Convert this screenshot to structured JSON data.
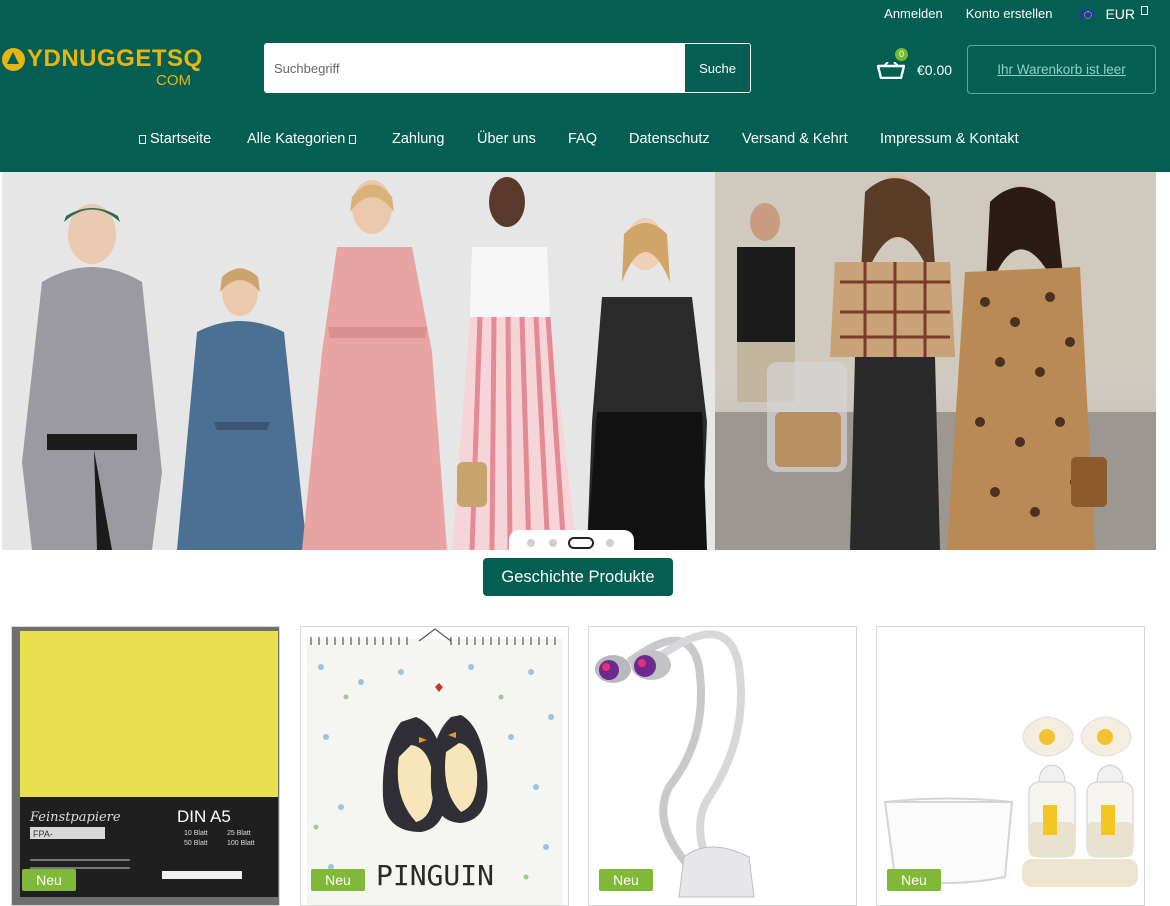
{
  "topbar": {
    "login": "Anmelden",
    "register": "Konto erstellen",
    "currency": "EUR"
  },
  "logo": {
    "name": "YDNUGGETSQ",
    "sub": "COM"
  },
  "search": {
    "placeholder": "Suchbegriff",
    "button": "Suche"
  },
  "cart": {
    "count": "0",
    "total": "€0.00",
    "status": "Ihr Warenkorb ist leer"
  },
  "nav": [
    {
      "label": "Startseite"
    },
    {
      "label": "Alle Kategorien"
    },
    {
      "label": "Zahlung"
    },
    {
      "label": "Über uns"
    },
    {
      "label": "FAQ"
    },
    {
      "label": "Datenschutz"
    },
    {
      "label": "Versand & Kehrt"
    },
    {
      "label": "Impressum & Kontakt"
    }
  ],
  "slider": {
    "slides": 4,
    "active": 3
  },
  "cta": {
    "label": "Geschichte Produkte"
  },
  "products": [
    {
      "badge": "Neu",
      "image": "paper-pack",
      "texts": {
        "brand": "Feinstpapiere",
        "format": "DIN A5",
        "code": "FPA-",
        "opts": [
          "10 Blatt",
          "25 Blatt",
          "50 Blatt",
          "100 Blatt"
        ]
      }
    },
    {
      "badge": "Neu",
      "image": "penguin-calendar",
      "texts": {
        "title": "PINGUIN"
      }
    },
    {
      "badge": "Neu",
      "image": "grow-lamp"
    },
    {
      "badge": "Neu",
      "image": "baby-bottles"
    }
  ],
  "colors": {
    "brand": "#045f52",
    "accent": "#e5b511",
    "badge": "#80b83a"
  }
}
